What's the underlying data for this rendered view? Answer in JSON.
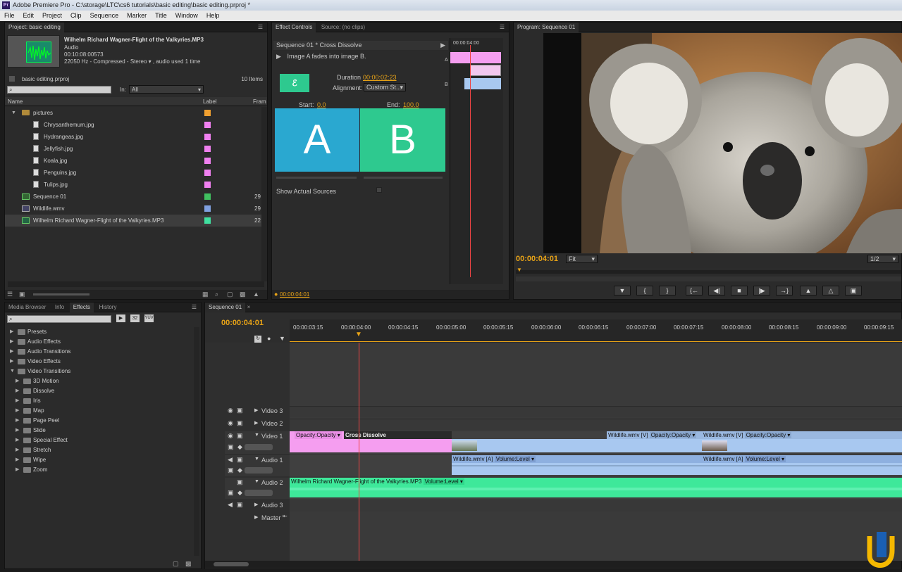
{
  "window": {
    "title": "Adobe Premiere Pro - C:\\storage\\LTC\\cs6 tutorials\\basic editing\\basic editing.prproj *",
    "app_icon": "Pr"
  },
  "menu": [
    "File",
    "Edit",
    "Project",
    "Clip",
    "Sequence",
    "Marker",
    "Title",
    "Window",
    "Help"
  ],
  "project": {
    "tab": "Project: basic editing",
    "clip_name": "Wilhelm Richard Wagner-Flight of the Valkyries.MP3",
    "clip_type": "Audio",
    "clip_duration": "00:10:08:00573",
    "clip_info": "22050 Hz - Compressed - Stereo  ▾  , audio used 1 time",
    "project_file": "basic editing.prproj",
    "item_count": "10 Items",
    "in_label": "In:",
    "in_value": "All",
    "columns": {
      "name": "Name",
      "label": "Label",
      "frame": "Fram"
    },
    "items": [
      {
        "name": "pictures",
        "kind": "folder",
        "color": "#f0a030",
        "rate": ""
      },
      {
        "name": "Chrysanthemum.jpg",
        "kind": "file",
        "color": "#f080f0",
        "rate": ""
      },
      {
        "name": "Hydrangeas.jpg",
        "kind": "file",
        "color": "#f080f0",
        "rate": ""
      },
      {
        "name": "Jellyfish.jpg",
        "kind": "file",
        "color": "#f080f0",
        "rate": ""
      },
      {
        "name": "Koala.jpg",
        "kind": "file",
        "color": "#f080f0",
        "rate": ""
      },
      {
        "name": "Penguins.jpg",
        "kind": "file",
        "color": "#f080f0",
        "rate": ""
      },
      {
        "name": "Tulips.jpg",
        "kind": "file",
        "color": "#f080f0",
        "rate": ""
      },
      {
        "name": "Sequence 01",
        "kind": "sequence",
        "color": "#40c060",
        "rate": "29"
      },
      {
        "name": "Wildlife.wmv",
        "kind": "video",
        "color": "#80a0e0",
        "rate": "29"
      },
      {
        "name": "Wilhelm Richard Wagner-Flight of the Valkyries.MP3",
        "kind": "audio",
        "color": "#40e0a0",
        "rate": "22"
      }
    ]
  },
  "effect_controls": {
    "tabs": [
      "Effect Controls",
      "Source: (no clips)"
    ],
    "heading": "Sequence 01 * Cross Dissolve",
    "description": "Image A fades into image B.",
    "duration_label": "Duration",
    "duration_value": "00:00:02:23",
    "alignment_label": "Alignment:",
    "alignment_value": "Custom St...",
    "start_label": "Start:",
    "start_value": "0.0",
    "end_label": "End:",
    "end_value": "100.0",
    "a_letter": "A",
    "b_letter": "B",
    "show_sources": "Show Actual Sources",
    "mini_timecode": "00:00:04:00",
    "footer_timecode": "00:00:04:01",
    "mini_labels": [
      "A",
      "B"
    ]
  },
  "program": {
    "tab": "Program: Sequence 01",
    "timecode": "00:00:04:01",
    "fit": "Fit",
    "resolution": "1/2"
  },
  "effects": {
    "tabs": [
      "Media Browser",
      "Info",
      "Effects",
      "History"
    ],
    "tree": [
      {
        "label": "Presets",
        "level": 0,
        "open": false
      },
      {
        "label": "Audio Effects",
        "level": 0,
        "open": false
      },
      {
        "label": "Audio Transitions",
        "level": 0,
        "open": false
      },
      {
        "label": "Video Effects",
        "level": 0,
        "open": false
      },
      {
        "label": "Video Transitions",
        "level": 0,
        "open": true
      },
      {
        "label": "3D Motion",
        "level": 1,
        "open": false
      },
      {
        "label": "Dissolve",
        "level": 1,
        "open": false
      },
      {
        "label": "Iris",
        "level": 1,
        "open": false
      },
      {
        "label": "Map",
        "level": 1,
        "open": false
      },
      {
        "label": "Page Peel",
        "level": 1,
        "open": false
      },
      {
        "label": "Slide",
        "level": 1,
        "open": false
      },
      {
        "label": "Special Effect",
        "level": 1,
        "open": false
      },
      {
        "label": "Stretch",
        "level": 1,
        "open": false
      },
      {
        "label": "Wipe",
        "level": 1,
        "open": false
      },
      {
        "label": "Zoom",
        "level": 1,
        "open": false
      }
    ]
  },
  "timeline": {
    "tab": "Sequence 01",
    "timecode": "00:00:04:01",
    "ruler": [
      "00:00:03:15",
      "00:00:04:00",
      "00:00:04:15",
      "00:00:05:00",
      "00:00:05:15",
      "00:00:06:00",
      "00:00:06:15",
      "00:00:07:00",
      "00:00:07:15",
      "00:00:08:00",
      "00:00:08:15",
      "00:00:09:00",
      "00:00:09:15"
    ],
    "tracks": [
      "Video 3",
      "Video 2",
      "Video 1",
      "Audio 1",
      "Audio 2",
      "Audio 3",
      "Master"
    ],
    "clips": {
      "v1_first": "Opacity:Opacity ▾",
      "transition": "Cross Dissolve",
      "v1_wild1": "Wildlife.wmv [V]",
      "v1_wild1_fx": "Opacity:Opacity ▾",
      "v1_wild2": "Wildlife.wmv [V]",
      "v1_wild2_fx": "Opacity:Opacity ▾",
      "a1_wild1": "Wildlife.wmv [A]",
      "a1_wild1_fx": "Volume:Level ▾",
      "a1_wild2": "Wildlife.wmv [A]",
      "a1_wild2_fx": "Volume:Level ▾",
      "a2_music": "Wilhelm Richard Wagner-Flight of the Valkyries.MP3",
      "a2_music_fx": "Volume:Level ▾"
    }
  },
  "colors": {
    "accent": "#e8a317",
    "pink_clip": "#f59ef0",
    "blue_clip": "#a8c8f0",
    "audio_clip": "#3ee89a",
    "a_box": "#2aa8d0",
    "b_box": "#2ec98f"
  }
}
